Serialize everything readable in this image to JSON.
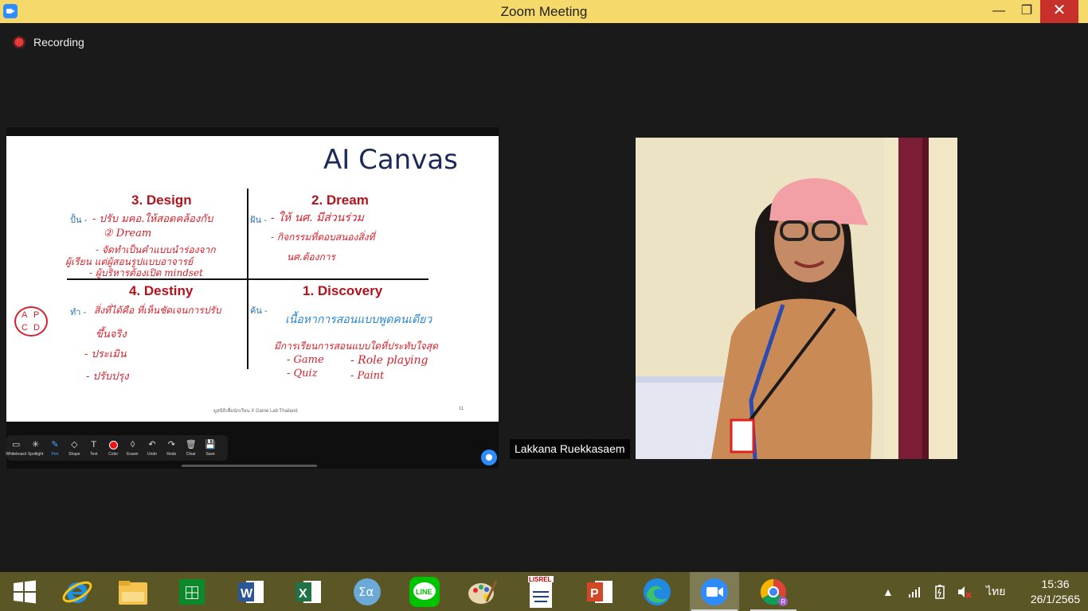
{
  "window": {
    "title": "Zoom Meeting",
    "minimize_glyph": "—",
    "maximize_glyph": "❐",
    "close_glyph": "✕"
  },
  "meeting": {
    "recording_label": "Recording"
  },
  "slide": {
    "title": "AI Canvas",
    "quadrants": [
      {
        "title": "3. Design",
        "side_label": "ปั้น -"
      },
      {
        "title": "2. Dream",
        "side_label": "ฝัน -"
      },
      {
        "title": "4. Destiny",
        "side_label": "ทำ -"
      },
      {
        "title": "1. Discovery",
        "side_label": "ค้น -"
      }
    ],
    "annotations": {
      "design": [
        "- ปรับ มคอ.ให้สอดคล้องกับ",
        "② Dream",
        "- จัดทำเป็นคำแบบนำร่องจาก",
        "ผู้เรียน แต่ผู้สอนรูปแบบอาจารย์",
        "- ผู้บริหารต้องเปิด mindset"
      ],
      "dream": [
        "- ให้ นศ. มีส่วนร่วม",
        "- กิจกรรมที่ตอบสนองสิ่งที่",
        "นศ.ต้องการ"
      ],
      "destiny": [
        "สิ่งที่ได้คือ ที่เห็นชัดเจนการปรับ",
        "ขึ้นจริง",
        "- ประเมิน",
        "- ปรับปรุง"
      ],
      "discovery_blue": "เนื้อหาการสอนแบบพูดคนเดียว",
      "discovery": [
        "มีการเรียนการสอนแบบใดที่ประทับใจสุด",
        "- Game",
        "- Role playing",
        "- Quiz",
        "- Paint"
      ],
      "abcd": [
        "A",
        "P",
        "C",
        "D"
      ]
    },
    "footer": "มูลนิธิเพื่อนักเรียน X Game Lab Thailand",
    "page_number": "11"
  },
  "annotation_toolbar": {
    "tools": [
      {
        "label": "Whiteboard",
        "icon": "▭"
      },
      {
        "label": "Spotlight",
        "icon": "✳"
      },
      {
        "label": "Pen",
        "icon": "✎"
      },
      {
        "label": "Shape",
        "icon": "◇"
      },
      {
        "label": "Text",
        "icon": "T"
      },
      {
        "label": "Color",
        "icon": ""
      },
      {
        "label": "Eraser",
        "icon": "◊"
      },
      {
        "label": "Undo",
        "icon": "↶"
      },
      {
        "label": "Redo",
        "icon": "↷"
      },
      {
        "label": "Clear",
        "icon": "🗑"
      },
      {
        "label": "Save",
        "icon": "💾"
      }
    ],
    "active_tool": "Pen",
    "selected_color": "#e11111"
  },
  "participant": {
    "name": "Lakkana Ruekkasaem"
  },
  "taskbar": {
    "apps": [
      "start",
      "internet-explorer",
      "file-explorer",
      "store",
      "word",
      "excel",
      "math-input",
      "line",
      "paint",
      "lisrel",
      "powerpoint",
      "edge",
      "zoom",
      "chrome"
    ],
    "active_app": "zoom",
    "tray": {
      "language": "ไทย",
      "time": "15:36",
      "date": "26/1/2565"
    }
  },
  "colors": {
    "titlebar": "#f6d96b",
    "close": "#c8312b",
    "taskbar": "#5b5626",
    "slide_title": "#1c2a5a",
    "quadrant_title": "#b3121c",
    "ink_red": "#d6202b",
    "ink_blue": "#2b86cf"
  }
}
